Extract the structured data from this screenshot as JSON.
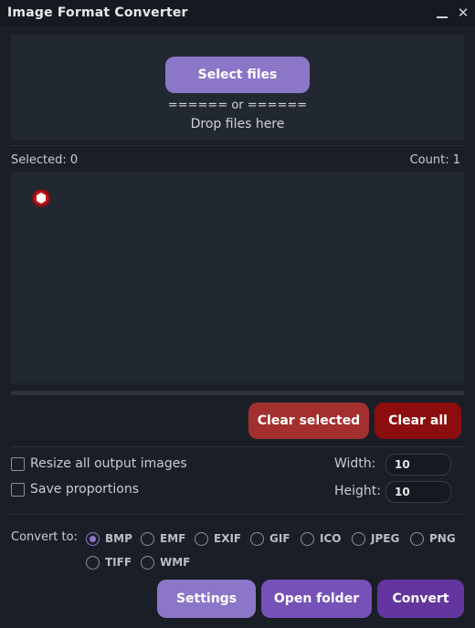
{
  "window": {
    "title": "Image Format Converter",
    "minimize_icon": "minimize-icon",
    "close_symbol": "✕"
  },
  "dropzone": {
    "select_label": "Select files",
    "or_line": "====== or ======",
    "drop_text": "Drop files here"
  },
  "list": {
    "selected_text": "Selected: 0",
    "count_text": "Count: 1",
    "file_icon": "image-file-icon",
    "file_icon_color": "#c0131a"
  },
  "actions": {
    "clear_selected_label": "Clear selected",
    "clear_all_label": "Clear all"
  },
  "resize": {
    "resize_label": "Resize all output images",
    "resize_checked": false,
    "proportions_label": "Save proportions",
    "proportions_checked": false,
    "width_label": "Width:",
    "width_value": "10",
    "height_label": "Height:",
    "height_value": "10"
  },
  "convert": {
    "label": "Convert to:",
    "formats": [
      "BMP",
      "EMF",
      "EXIF",
      "GIF",
      "ICO",
      "JPEG",
      "PNG",
      "TIFF",
      "WMF"
    ],
    "selected_format": "BMP"
  },
  "footer": {
    "settings_label": "Settings",
    "open_folder_label": "Open folder",
    "convert_label": "Convert"
  },
  "colors": {
    "accent": "#8c76c8",
    "danger": "#a32f2f",
    "danger_dark": "#8b0d0d",
    "background": "#1a1f27",
    "panel": "#222832"
  }
}
